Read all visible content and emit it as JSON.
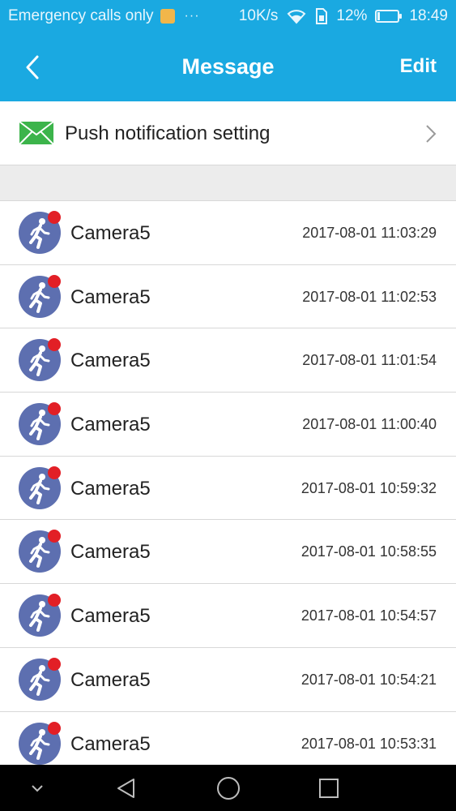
{
  "status_bar": {
    "carrier": "Emergency calls only",
    "dots": "···",
    "network_speed": "10K/s",
    "battery_percent": "12%",
    "battery_level": 0.12,
    "time": "18:49"
  },
  "header": {
    "title": "Message",
    "edit_label": "Edit"
  },
  "push_setting": {
    "label": "Push notification setting"
  },
  "messages": [
    {
      "name": "Camera5",
      "time": "2017-08-01 11:03:29"
    },
    {
      "name": "Camera5",
      "time": "2017-08-01 11:02:53"
    },
    {
      "name": "Camera5",
      "time": "2017-08-01 11:01:54"
    },
    {
      "name": "Camera5",
      "time": "2017-08-01 11:00:40"
    },
    {
      "name": "Camera5",
      "time": "2017-08-01 10:59:32"
    },
    {
      "name": "Camera5",
      "time": "2017-08-01 10:58:55"
    },
    {
      "name": "Camera5",
      "time": "2017-08-01 10:54:57"
    },
    {
      "name": "Camera5",
      "time": "2017-08-01 10:54:21"
    },
    {
      "name": "Camera5",
      "time": "2017-08-01 10:53:31"
    }
  ],
  "colors": {
    "accent": "#1aa9e1",
    "avatar": "#5d6fb0",
    "unread": "#e21f26",
    "mail_icon": "#3cb44b"
  },
  "icons": {
    "back": "chevron-left-icon",
    "mail": "mail-icon",
    "chevron": "chevron-right-icon",
    "motion": "walking-person-icon",
    "nav": [
      "chevron-down-icon",
      "back-triangle-icon",
      "home-circle-icon",
      "recents-square-icon"
    ]
  }
}
